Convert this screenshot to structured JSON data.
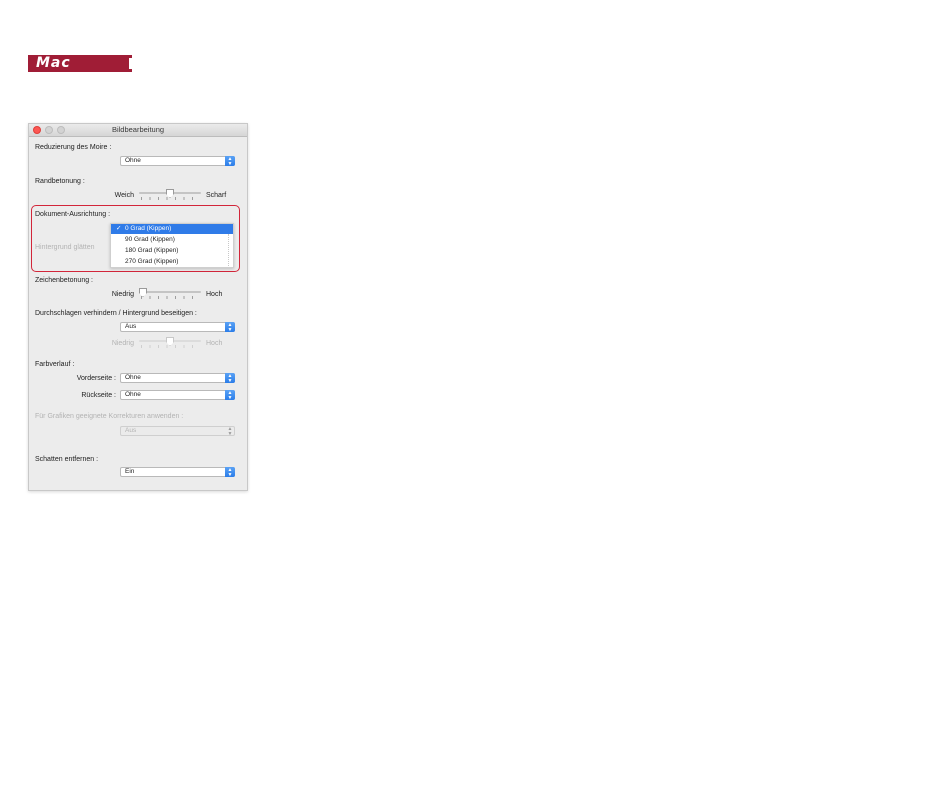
{
  "badge": {
    "label": "Mac"
  },
  "window": {
    "title": "Bildbearbeitung",
    "moire": {
      "label": "Reduzierung des Moire :",
      "value": "Ohne"
    },
    "edge": {
      "label": "Randbetonung :",
      "min_label": "Weich",
      "max_label": "Scharf",
      "level": 0.5
    },
    "orientation": {
      "label": "Dokument-Ausrichtung :",
      "menu": {
        "options": [
          "0 Grad (Kippen)",
          "90 Grad (Kippen)",
          "180 Grad (Kippen)",
          "270 Grad (Kippen)"
        ],
        "selected": "0 Grad (Kippen)",
        "check_glyph": "✓"
      }
    },
    "smooth_background": {
      "label": "Hintergrund glätten"
    },
    "character": {
      "label": "Zeichenbetonung :",
      "min_label": "Niedrig",
      "max_label": "Hoch",
      "level": 0.0
    },
    "bleed": {
      "label": "Durchschlagen verhindern / Hintergrund beseitigen :",
      "value": "Aus",
      "min_label": "Niedrig",
      "max_label": "Hoch",
      "level": 0.5
    },
    "gradient": {
      "label": "Farbverlauf :",
      "front_label": "Vorderseite :",
      "front_value": "Ohne",
      "back_label": "Rückseite :",
      "back_value": "Ohne"
    },
    "graphics": {
      "label": "Für Grafiken geeignete Korrekturen anwenden :",
      "value": "Aus"
    },
    "shadow": {
      "label": "Schatten entfernen :",
      "value": "Ein"
    }
  },
  "colors": {
    "badge": "#a01d36",
    "accent": "#2f7be8",
    "highlight": "#d2263a"
  },
  "icons": {
    "select_arrow": "up-down-chevron-icon",
    "slider_thumb": "slider-thumb-icon"
  }
}
